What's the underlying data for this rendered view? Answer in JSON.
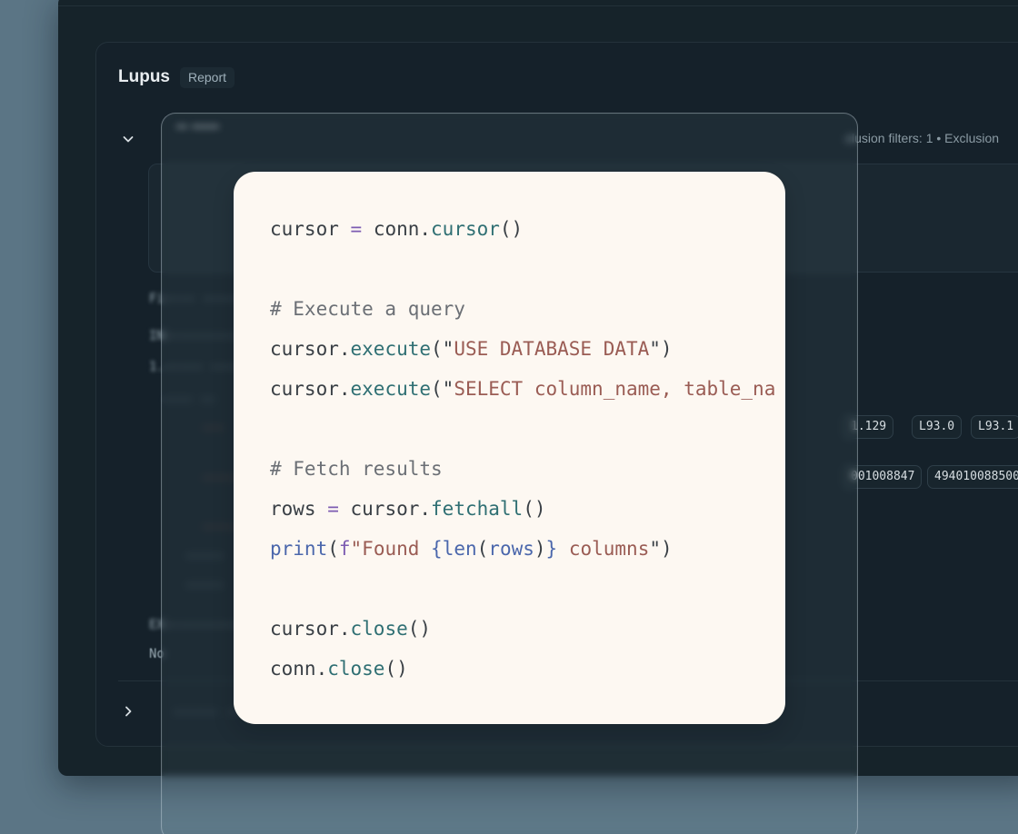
{
  "report": {
    "title": "Lupus",
    "badge": "Report"
  },
  "filters": {
    "summary": "clusion filters: 1 • Exclusion"
  },
  "background_chips": [
    "1.129",
    "L93.0",
    "L93.1",
    "001008847",
    "494010088500"
  ],
  "colors": {
    "background": "#5b7585",
    "window": "#16232a",
    "code_bg": "#fdf8f2"
  },
  "icons": {
    "chevron_down": "chevron-down-icon",
    "chevron_right": "chevron-right-icon"
  },
  "code": {
    "lines": [
      [
        {
          "text": "cursor ",
          "kind": "plain"
        },
        {
          "text": "=",
          "kind": "op"
        },
        {
          "text": " conn.",
          "kind": "plain"
        },
        {
          "text": "cursor",
          "kind": "fn"
        },
        {
          "text": "()",
          "kind": "plain"
        }
      ],
      [],
      [
        {
          "text": "# Execute a query",
          "kind": "comment"
        }
      ],
      [
        {
          "text": "cursor.",
          "kind": "plain"
        },
        {
          "text": "execute",
          "kind": "fn"
        },
        {
          "text": "(\"",
          "kind": "plain"
        },
        {
          "text": "USE DATABASE DATA",
          "kind": "str"
        },
        {
          "text": "\")",
          "kind": "plain"
        }
      ],
      [
        {
          "text": "cursor.",
          "kind": "plain"
        },
        {
          "text": "execute",
          "kind": "fn"
        },
        {
          "text": "(\"",
          "kind": "plain"
        },
        {
          "text": "SELECT column_name, table_na",
          "kind": "str"
        }
      ],
      [],
      [
        {
          "text": "# Fetch results",
          "kind": "comment"
        }
      ],
      [
        {
          "text": "rows ",
          "kind": "plain"
        },
        {
          "text": "=",
          "kind": "op"
        },
        {
          "text": " cursor.",
          "kind": "plain"
        },
        {
          "text": "fetchall",
          "kind": "fn"
        },
        {
          "text": "()",
          "kind": "plain"
        }
      ],
      [
        {
          "text": "print",
          "kind": "builtin"
        },
        {
          "text": "(",
          "kind": "plain"
        },
        {
          "text": "f",
          "kind": "prefix"
        },
        {
          "text": "\"Found ",
          "kind": "str"
        },
        {
          "text": "{",
          "kind": "brace"
        },
        {
          "text": "len",
          "kind": "builtin"
        },
        {
          "text": "(",
          "kind": "plain"
        },
        {
          "text": "rows",
          "kind": "builtin"
        },
        {
          "text": ")",
          "kind": "plain"
        },
        {
          "text": "}",
          "kind": "brace"
        },
        {
          "text": " columns",
          "kind": "str"
        },
        {
          "text": "\")",
          "kind": "plain"
        }
      ],
      [],
      [
        {
          "text": "cursor.",
          "kind": "plain"
        },
        {
          "text": "close",
          "kind": "fn"
        },
        {
          "text": "()",
          "kind": "plain"
        }
      ],
      [
        {
          "text": "conn.",
          "kind": "plain"
        },
        {
          "text": "close",
          "kind": "fn"
        },
        {
          "text": "()",
          "kind": "plain"
        }
      ]
    ]
  }
}
